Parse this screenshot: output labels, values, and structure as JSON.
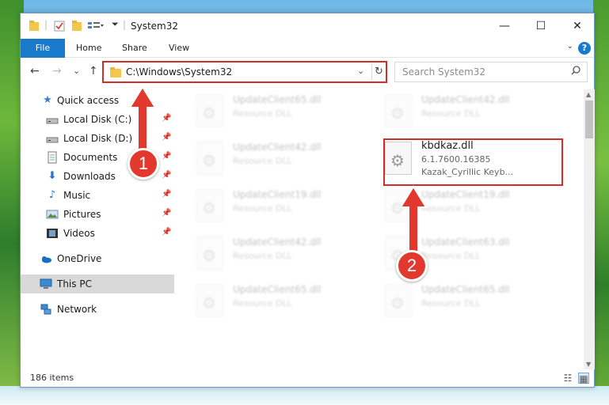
{
  "window": {
    "title": "System32",
    "controls": {
      "minimize": "—",
      "maximize": "☐",
      "close": "✕"
    }
  },
  "ribbon": {
    "tabs": [
      "File",
      "Home",
      "Share",
      "View"
    ],
    "help": "?"
  },
  "nav": {
    "back": "←",
    "forward": "→",
    "recent": "⌄",
    "up": "↑",
    "address": "C:\\Windows\\System32",
    "search_placeholder": "Search System32"
  },
  "sidebar": {
    "items": [
      {
        "label": "Quick access",
        "icon": "star-icon"
      },
      {
        "label": "Local Disk (C:)",
        "icon": "drive-icon",
        "pinned": true
      },
      {
        "label": "Local Disk (D:)",
        "icon": "drive-icon",
        "pinned": true
      },
      {
        "label": "Documents",
        "icon": "documents-icon",
        "pinned": true
      },
      {
        "label": "Downloads",
        "icon": "downloads-icon",
        "pinned": true
      },
      {
        "label": "Music",
        "icon": "music-icon",
        "pinned": true
      },
      {
        "label": "Pictures",
        "icon": "pictures-icon",
        "pinned": true
      },
      {
        "label": "Videos",
        "icon": "videos-icon",
        "pinned": true
      },
      {
        "label": "OneDrive",
        "icon": "cloud-icon"
      },
      {
        "label": "This PC",
        "icon": "computer-icon",
        "selected": true
      },
      {
        "label": "Network",
        "icon": "network-icon"
      }
    ]
  },
  "files": {
    "col1": [
      {
        "name": "UpdateClient65.dll",
        "desc": "Resource DLL"
      },
      {
        "name": "UpdateClient42.dll",
        "desc": "Resource DLL"
      },
      {
        "name": "UpdateClient19.dll",
        "desc": "Resource DLL"
      },
      {
        "name": "UpdateClient42.dll",
        "desc": "Resource DLL"
      },
      {
        "name": "UpdateClient65.dll",
        "desc": "Resource DLL"
      }
    ],
    "col2": [
      {
        "name": "UpdateClient42.dll",
        "desc": "Resource DLL"
      },
      {
        "name": "kbdkaz.dll",
        "version": "6.1.7600.16385",
        "desc": "Kazak_Cyrillic Keyb..."
      },
      {
        "name": "UpdateClient19.dll",
        "desc": "Resource DLL"
      },
      {
        "name": "UpdateClient63.dll",
        "desc": "Resource DLL"
      },
      {
        "name": "UpdateClient65.dll",
        "desc": "Resource DLL"
      }
    ]
  },
  "status": {
    "items": "186 items"
  },
  "annotations": {
    "badge1": "1",
    "badge2": "2",
    "color": "#e2382d"
  }
}
